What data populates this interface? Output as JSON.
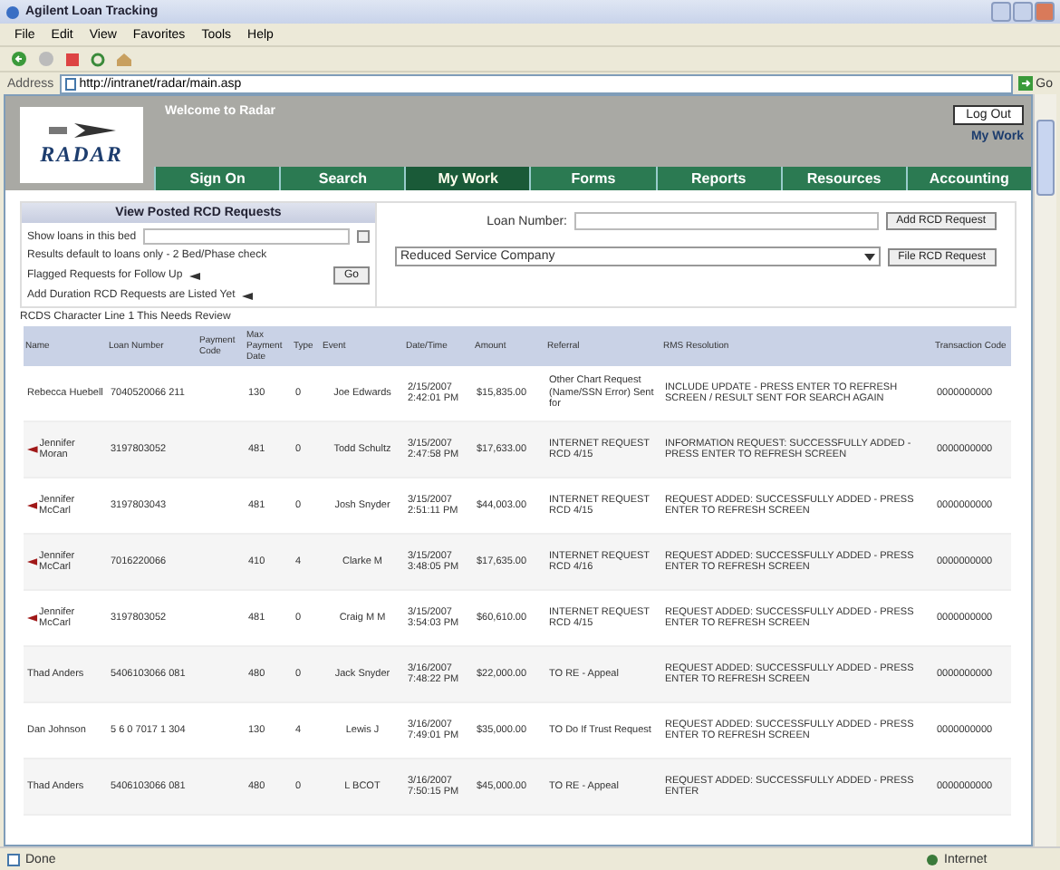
{
  "window": {
    "title": "Agilent Loan Tracking"
  },
  "menu": [
    "File",
    "Edit",
    "View",
    "Favorites",
    "Tools",
    "Help"
  ],
  "address": {
    "label": "Address",
    "value": "http://intranet/radar/main.asp",
    "go": "Go"
  },
  "header": {
    "logo": "RADAR",
    "welcome": "Welcome to Radar",
    "logout_button": "Log Out",
    "user": "My Work",
    "nav": [
      {
        "label": "Sign On",
        "selected": false
      },
      {
        "label": "Search",
        "selected": false
      },
      {
        "label": "My Work",
        "selected": true
      },
      {
        "label": "Forms",
        "selected": false
      },
      {
        "label": "Reports",
        "selected": false
      },
      {
        "label": "Resources",
        "selected": false
      },
      {
        "label": "Accounting",
        "selected": false
      }
    ]
  },
  "filter_panel": {
    "title": "View Posted RCD Requests",
    "field_label": "Show loans in this bed",
    "lines": [
      "Results default to loans only - 2 Bed/Phase check",
      "Flagged Requests for Follow Up",
      "Add Duration RCD Requests are Listed Yet"
    ],
    "go_button": "Go"
  },
  "request_form": {
    "loan_label": "Loan Number:",
    "add_button": "Add RCD Request",
    "company": "Reduced Service Company",
    "file_button": "File RCD Request"
  },
  "note": "RCDS Character Line 1 This Needs Review",
  "table": {
    "columns": [
      "Name",
      "Loan Number",
      "Payment Code",
      "Max Payment Date",
      "Type",
      "Event",
      "Date/Time",
      "Amount",
      "Referral",
      "RMS Resolution",
      "Transaction Code"
    ],
    "rows": [
      {
        "flagged": false,
        "cells": [
          "Rebecca Huebell",
          "7040520066 211",
          "",
          "130",
          "0",
          "Joe Edwards",
          "2/15/2007 2:42:01 PM",
          "$15,835.00",
          "Other Chart Request (Name/SSN Error) Sent for",
          "INCLUDE UPDATE - PRESS ENTER TO REFRESH SCREEN / RESULT SENT FOR SEARCH AGAIN",
          "0000000000"
        ]
      },
      {
        "flagged": true,
        "cells": [
          "Jennifer Moran",
          "3197803052",
          "",
          "481",
          "0",
          "Todd Schultz",
          "3/15/2007 2:47:58 PM",
          "$17,633.00",
          "INTERNET REQUEST RCD 4/15",
          "INFORMATION REQUEST: SUCCESSFULLY ADDED - PRESS ENTER TO REFRESH SCREEN",
          "0000000000"
        ]
      },
      {
        "flagged": true,
        "cells": [
          "Jennifer McCarl",
          "3197803043",
          "",
          "481",
          "0",
          "Josh Snyder",
          "3/15/2007 2:51:11 PM",
          "$44,003.00",
          "INTERNET REQUEST RCD 4/15",
          "REQUEST ADDED: SUCCESSFULLY ADDED - PRESS ENTER TO REFRESH SCREEN",
          "0000000000"
        ]
      },
      {
        "flagged": true,
        "cells": [
          "Jennifer McCarl",
          "7016220066",
          "",
          "410",
          "4",
          "Clarke M",
          "3/15/2007 3:48:05 PM",
          "$17,635.00",
          "INTERNET REQUEST RCD 4/16",
          "REQUEST ADDED: SUCCESSFULLY ADDED - PRESS ENTER TO REFRESH SCREEN",
          "0000000000"
        ]
      },
      {
        "flagged": true,
        "cells": [
          "Jennifer McCarl",
          "3197803052",
          "",
          "481",
          "0",
          "Craig M M",
          "3/15/2007 3:54:03 PM",
          "$60,610.00",
          "INTERNET REQUEST RCD 4/15",
          "REQUEST ADDED: SUCCESSFULLY ADDED - PRESS ENTER TO REFRESH SCREEN",
          "0000000000"
        ]
      },
      {
        "flagged": false,
        "cells": [
          "Thad Anders",
          "5406103066 081",
          "",
          "480",
          "0",
          "Jack Snyder",
          "3/16/2007 7:48:22 PM",
          "$22,000.00",
          "TO RE - Appeal",
          "REQUEST ADDED: SUCCESSFULLY ADDED - PRESS ENTER TO REFRESH SCREEN",
          "0000000000"
        ]
      },
      {
        "flagged": false,
        "cells": [
          "Dan Johnson",
          "5 6 0 7017 1 304",
          "",
          "130",
          "4",
          "Lewis J",
          "3/16/2007 7:49:01 PM",
          "$35,000.00",
          "TO Do If Trust Request",
          "REQUEST ADDED: SUCCESSFULLY ADDED - PRESS ENTER TO REFRESH SCREEN",
          "0000000000"
        ]
      },
      {
        "flagged": false,
        "cells": [
          "Thad Anders",
          "5406103066 081",
          "",
          "480",
          "0",
          "L BCOT",
          "3/16/2007 7:50:15 PM",
          "$45,000.00",
          "TO RE - Appeal",
          "REQUEST ADDED: SUCCESSFULLY ADDED - PRESS ENTER",
          "0000000000"
        ]
      }
    ]
  },
  "status_bar": {
    "left": "Done",
    "right": "Internet"
  }
}
